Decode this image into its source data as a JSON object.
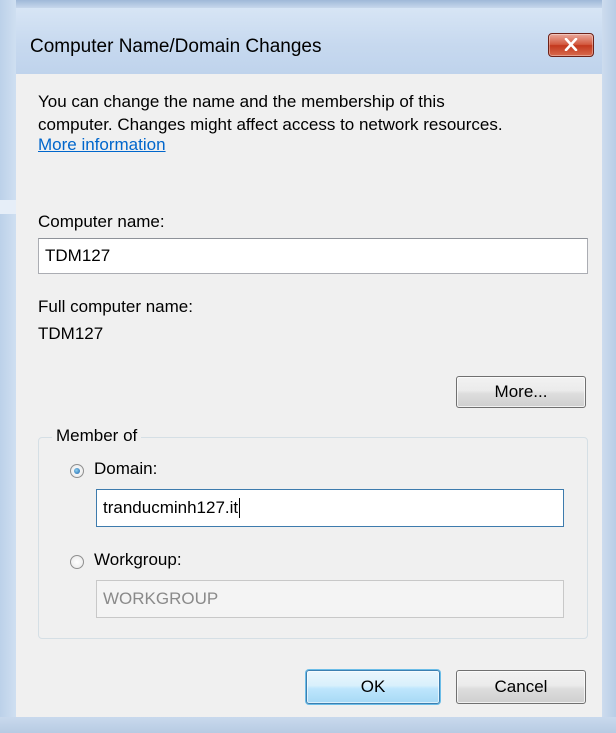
{
  "window": {
    "title": "Computer Name/Domain Changes"
  },
  "description": {
    "line1": "You can change the name and the membership of this",
    "line2": "computer. Changes might affect access to network resources.",
    "link": "More information"
  },
  "computer_name": {
    "label": "Computer name:",
    "value": "TDM127"
  },
  "full_computer_name": {
    "label": "Full computer name:",
    "value": "TDM127"
  },
  "buttons": {
    "more": "More...",
    "ok": "OK",
    "cancel": "Cancel"
  },
  "member_of": {
    "legend": "Member of",
    "domain": {
      "label": "Domain:",
      "value": "tranducminh127.it",
      "selected": true
    },
    "workgroup": {
      "label": "Workgroup:",
      "value": "WORKGROUP",
      "selected": false
    }
  },
  "colors": {
    "link": "#0066cc",
    "close_button": "#c3381d",
    "default_button": "#3c7fb1"
  }
}
